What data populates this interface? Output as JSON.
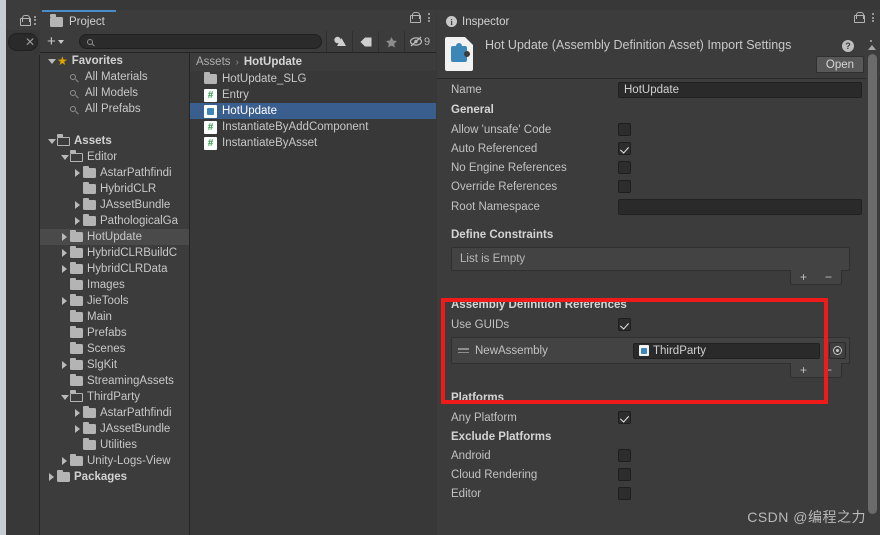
{
  "left_sliver": {
    "lock_icon": "lock-icon",
    "kebab_icon": "kebab-icon",
    "close_icon": "close-icon"
  },
  "project": {
    "tab_label": "Project",
    "folder_icon": "folder-icon",
    "lock_icon": "lock-icon",
    "kebab_icon": "kebab-icon",
    "toolbar": {
      "add_label": "+",
      "search_placeholder": "",
      "search_value": "",
      "search_icon": "search-icon",
      "buttons": [
        {
          "name": "shape-filter-icon",
          "glyph": "◑"
        },
        {
          "name": "label-filter-icon",
          "glyph": "✐"
        },
        {
          "name": "favorite-filter-icon",
          "glyph": "★"
        },
        {
          "name": "hidden-count-icon",
          "glyph": "⊘"
        }
      ],
      "hidden_count": "9"
    },
    "tree": [
      {
        "label": "Favorites",
        "depth": 0,
        "twisty": "down",
        "icon": "star",
        "bold": true
      },
      {
        "label": "All Materials",
        "depth": 1,
        "twisty": "none",
        "icon": "search",
        "bold": false
      },
      {
        "label": "All Models",
        "depth": 1,
        "twisty": "none",
        "icon": "search",
        "bold": false
      },
      {
        "label": "All Prefabs",
        "depth": 1,
        "twisty": "none",
        "icon": "search",
        "bold": false
      },
      {
        "label": "",
        "depth": 0,
        "twisty": "none",
        "icon": "none",
        "bold": false
      },
      {
        "label": "Assets",
        "depth": 0,
        "twisty": "down",
        "icon": "folder-open",
        "bold": true
      },
      {
        "label": "Editor",
        "depth": 1,
        "twisty": "down",
        "icon": "folder-open",
        "bold": false
      },
      {
        "label": "AstarPathfindi",
        "depth": 2,
        "twisty": "right",
        "icon": "folder",
        "bold": false
      },
      {
        "label": "HybridCLR",
        "depth": 2,
        "twisty": "none",
        "icon": "folder",
        "bold": false
      },
      {
        "label": "JAssetBundle",
        "depth": 2,
        "twisty": "right",
        "icon": "folder",
        "bold": false
      },
      {
        "label": "PathologicalGa",
        "depth": 2,
        "twisty": "right",
        "icon": "folder",
        "bold": false
      },
      {
        "label": "HotUpdate",
        "depth": 1,
        "twisty": "right",
        "icon": "folder",
        "bold": false,
        "selected": true
      },
      {
        "label": "HybridCLRBuildC",
        "depth": 1,
        "twisty": "right",
        "icon": "folder",
        "bold": false
      },
      {
        "label": "HybridCLRData",
        "depth": 1,
        "twisty": "right",
        "icon": "folder",
        "bold": false
      },
      {
        "label": "Images",
        "depth": 1,
        "twisty": "none",
        "icon": "folder",
        "bold": false
      },
      {
        "label": "JieTools",
        "depth": 1,
        "twisty": "right",
        "icon": "folder",
        "bold": false
      },
      {
        "label": "Main",
        "depth": 1,
        "twisty": "none",
        "icon": "folder",
        "bold": false
      },
      {
        "label": "Prefabs",
        "depth": 1,
        "twisty": "none",
        "icon": "folder",
        "bold": false
      },
      {
        "label": "Scenes",
        "depth": 1,
        "twisty": "none",
        "icon": "folder",
        "bold": false
      },
      {
        "label": "SlgKit",
        "depth": 1,
        "twisty": "right",
        "icon": "folder",
        "bold": false
      },
      {
        "label": "StreamingAssets",
        "depth": 1,
        "twisty": "none",
        "icon": "folder",
        "bold": false
      },
      {
        "label": "ThirdParty",
        "depth": 1,
        "twisty": "down",
        "icon": "folder-open",
        "bold": false
      },
      {
        "label": "AstarPathfindi",
        "depth": 2,
        "twisty": "right",
        "icon": "folder",
        "bold": false
      },
      {
        "label": "JAssetBundle",
        "depth": 2,
        "twisty": "right",
        "icon": "folder",
        "bold": false
      },
      {
        "label": "Utilities",
        "depth": 2,
        "twisty": "none",
        "icon": "folder",
        "bold": false
      },
      {
        "label": "Unity-Logs-View",
        "depth": 1,
        "twisty": "right",
        "icon": "folder",
        "bold": false
      },
      {
        "label": "Packages",
        "depth": 0,
        "twisty": "right",
        "icon": "folder",
        "bold": true
      }
    ],
    "breadcrumb": {
      "root": "Assets",
      "separator": "›",
      "current": "HotUpdate"
    },
    "files": [
      {
        "label": "HotUpdate_SLG",
        "icon": "folder",
        "selected": false
      },
      {
        "label": "Entry",
        "icon": "csharp",
        "selected": false
      },
      {
        "label": "HotUpdate",
        "icon": "asmdef",
        "selected": true
      },
      {
        "label": "InstantiateByAddComponent",
        "icon": "csharp",
        "selected": false
      },
      {
        "label": "InstantiateByAsset",
        "icon": "csharp",
        "selected": false
      }
    ]
  },
  "inspector": {
    "tab_label": "Inspector",
    "info_icon": "info-icon",
    "lock_icon": "lock-icon",
    "kebab_icon": "kebab-icon",
    "title": "Hot Update (Assembly Definition Asset) Import Settings",
    "help_icon": "help-icon",
    "header_kebab": "kebab-icon",
    "open_button": "Open",
    "asset_icon": "asmdef-icon",
    "name_label": "Name",
    "name_value": "HotUpdate",
    "general_header": "General",
    "general_rows": [
      {
        "label": "Allow 'unsafe' Code",
        "checked": false
      },
      {
        "label": "Auto Referenced",
        "checked": true
      },
      {
        "label": "No Engine References",
        "checked": false
      },
      {
        "label": "Override References",
        "checked": false
      }
    ],
    "root_namespace_label": "Root Namespace",
    "root_namespace_value": "",
    "define_constraints": {
      "header": "Define Constraints",
      "empty_text": "List is Empty",
      "add_label": "+",
      "remove_label": "−"
    },
    "assembly_refs": {
      "header": "Assembly Definition References",
      "use_guids_label": "Use GUIDs",
      "use_guids_checked": true,
      "drag_handle_icon": "drag-handle-icon",
      "entry_label": "NewAssembly",
      "entry_value": "ThirdParty",
      "entry_icon": "asmdef-icon",
      "picker_icon": "object-picker-icon",
      "add_label": "+",
      "remove_label": "−"
    },
    "platforms": {
      "header": "Platforms",
      "any_platform_label": "Any Platform",
      "any_platform_checked": true,
      "exclude_header": "Exclude Platforms",
      "rows": [
        {
          "label": "Android",
          "checked": false
        },
        {
          "label": "Cloud Rendering",
          "checked": false
        },
        {
          "label": "Editor",
          "checked": false
        }
      ]
    },
    "scrollbar": {
      "up_arrow_icon": "scroll-up-icon"
    }
  },
  "annotation": {
    "highlight_color": "#ef1a1a"
  },
  "watermark": "CSDN @编程之力"
}
